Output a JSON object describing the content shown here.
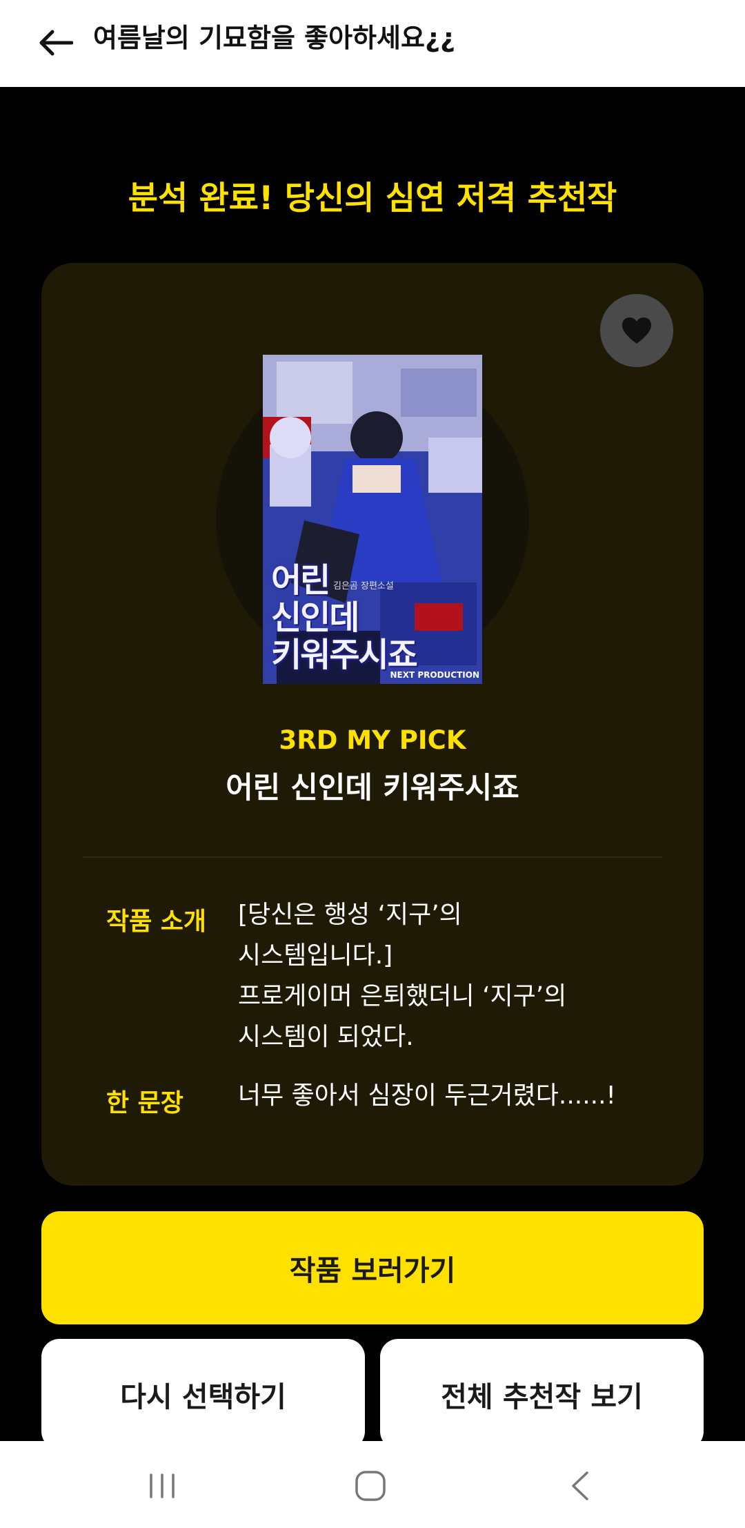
{
  "app_bar": {
    "title": "여름날의 기묘함을 좋아하세요¿¿"
  },
  "headline": "분석 완료! 당신의 심연 저격 추천작",
  "card": {
    "cover": {
      "author_line": "김은곰 장편소설",
      "title_lines": [
        "어린",
        "신인데",
        "키워주시죠"
      ],
      "publisher": "NEXT PRODUCTION"
    },
    "rank_label": "3RD MY PICK",
    "work_title": "어린 신인데 키워주시죠",
    "intro": {
      "label": "작품 소개",
      "lines": [
        "[당신은 행성 ‘지구’의",
        "시스템입니다.]",
        "프로게이머 은퇴했더니 ‘지구’의",
        "시스템이 되었다."
      ]
    },
    "one_line": {
      "label": "한 문장",
      "text": "너무 좋아서 심장이 두근거렸다......!"
    }
  },
  "buttons": {
    "view_work": "작품 보러가기",
    "reselect": "다시 선택하기",
    "all_recommendations": "전체 추천작 보기"
  },
  "icons": {
    "back": "arrow-left-icon",
    "favorite": "heart-icon",
    "recents": "recent-apps-icon",
    "home": "home-icon",
    "system_back": "chevron-left-icon"
  },
  "colors": {
    "accent": "#ffe100",
    "card_background": "#1e1a06",
    "page_background": "#000000"
  }
}
